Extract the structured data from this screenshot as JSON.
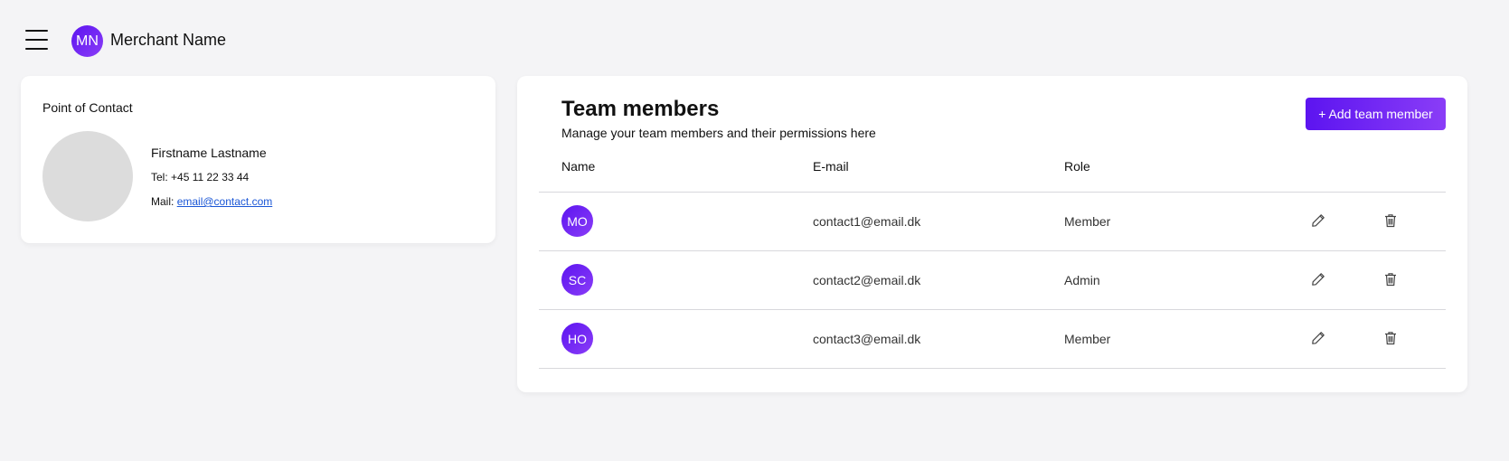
{
  "header": {
    "menu_icon": "hamburger-menu-icon",
    "merchant_initials": "MN",
    "merchant_name": "Merchant Name"
  },
  "point_of_contact": {
    "title": "Point of Contact",
    "name": "Firstname Lastname",
    "tel_label": "Tel:",
    "tel": "+45 11 22 33 44",
    "mail_label": "Mail:",
    "mail": "email@contact.com"
  },
  "team": {
    "title": "Team members",
    "subtitle": "Manage your team members and their permissions here",
    "add_button": "+ Add team member",
    "columns": {
      "name": "Name",
      "email": "E-mail",
      "role": "Role"
    },
    "members": [
      {
        "initials": "MO",
        "email": "contact1@email.dk",
        "role": "Member"
      },
      {
        "initials": "SC",
        "email": "contact2@email.dk",
        "role": "Admin"
      },
      {
        "initials": "HO",
        "email": "contact3@email.dk",
        "role": "Member"
      }
    ],
    "row_icons": {
      "edit": "pencil-icon",
      "delete": "trash-icon"
    }
  },
  "colors": {
    "accent_start": "#5c14f0",
    "accent_end": "#8a3df7",
    "background": "#f4f4f6",
    "link": "#1a56d6"
  }
}
